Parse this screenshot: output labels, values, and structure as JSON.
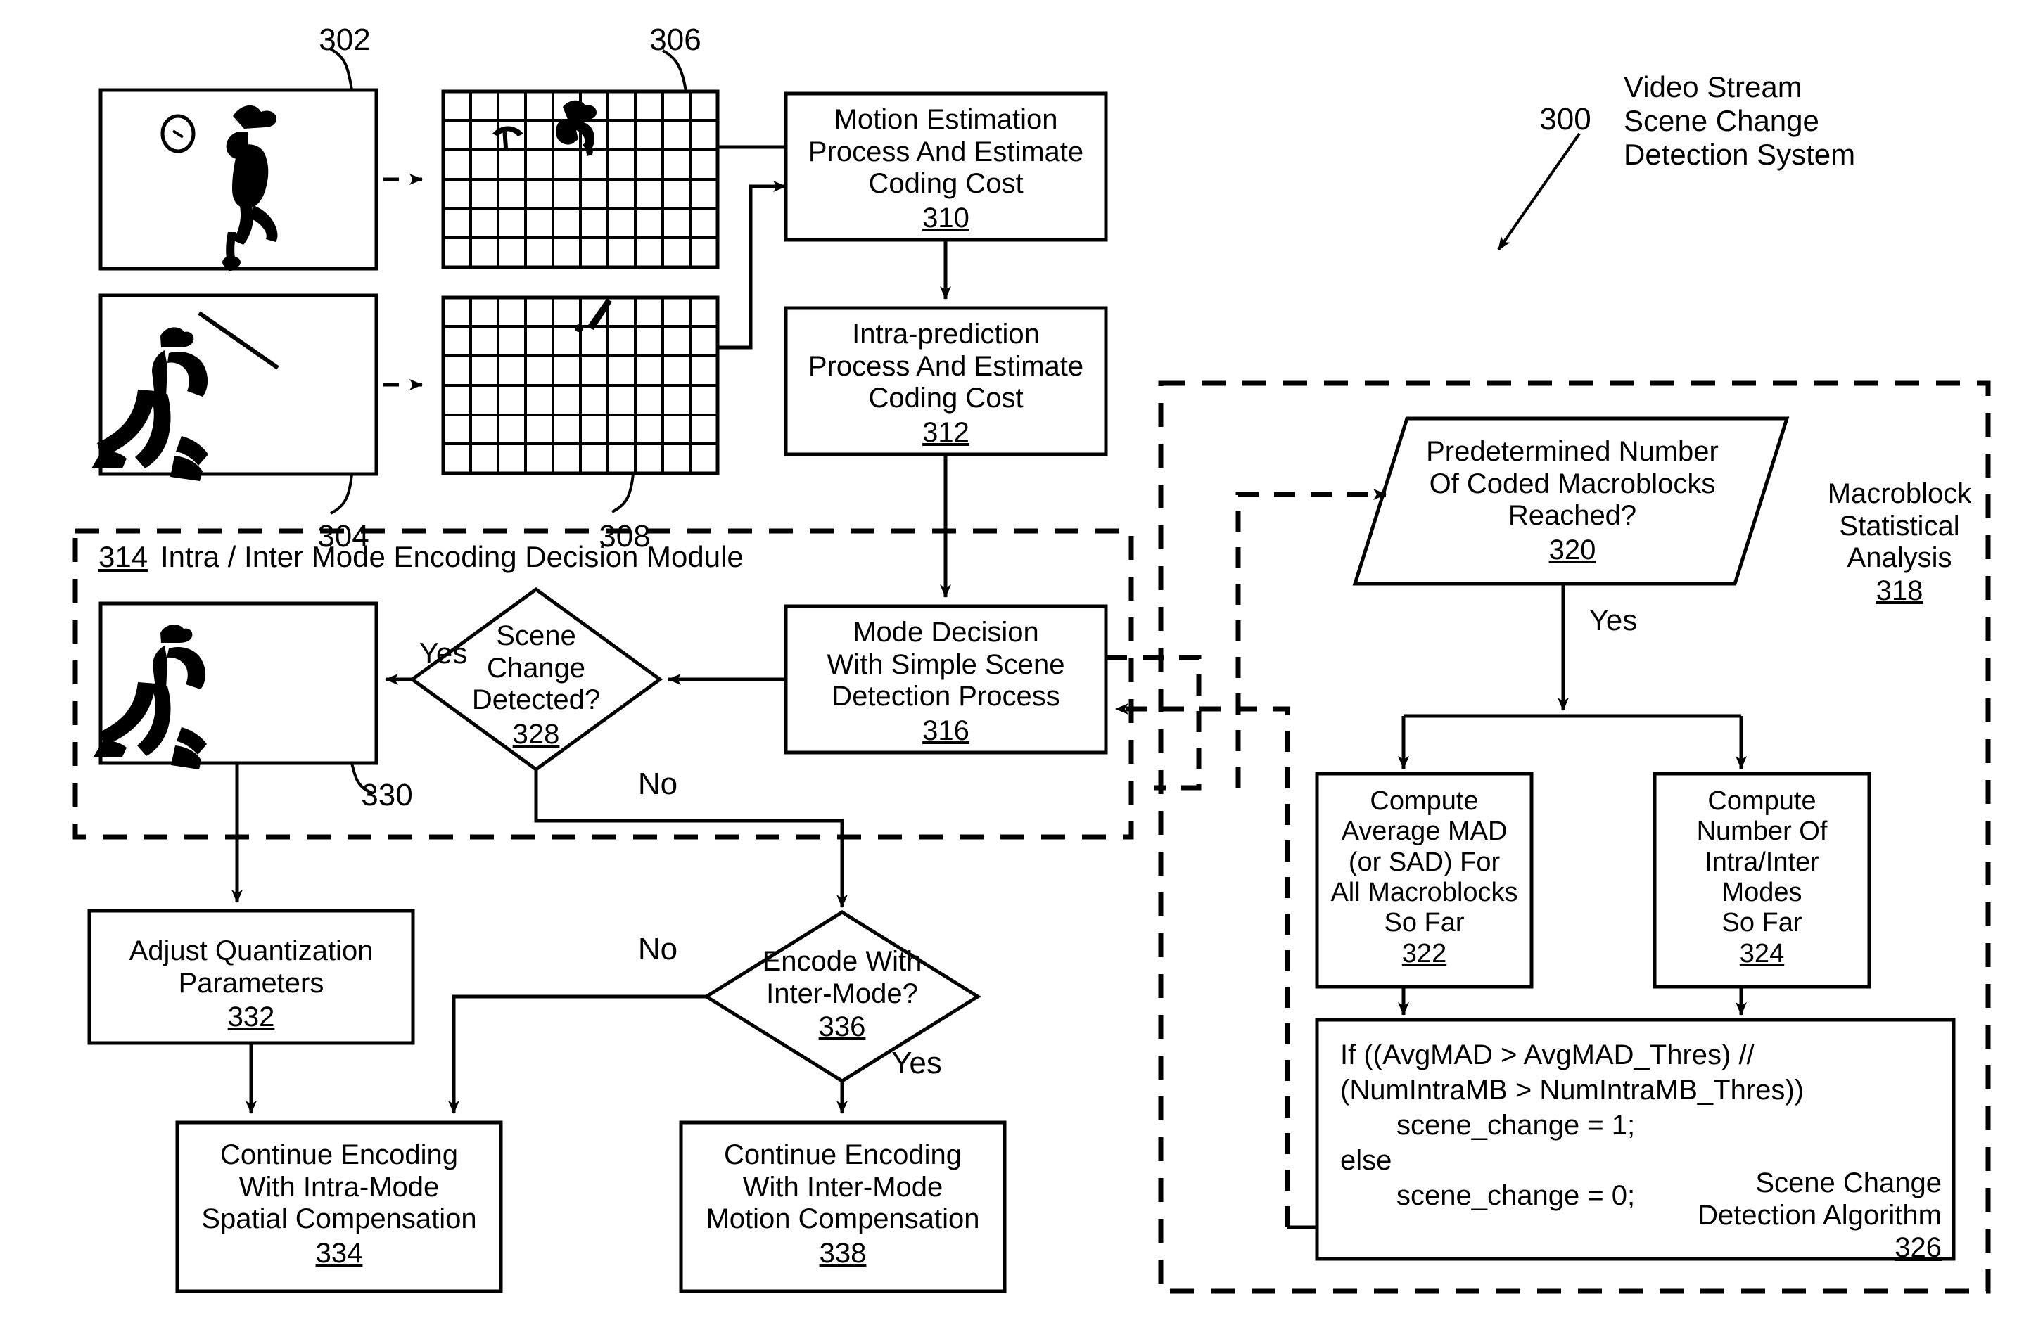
{
  "figure": {
    "ref_300": "300",
    "title": "Video Stream\nScene Change\nDetection System"
  },
  "frames": {
    "frame1_ref": "302",
    "frame2_ref": "304",
    "grid1_ref": "306",
    "grid2_ref": "308",
    "result_frame_ref": "330"
  },
  "boxes": {
    "b310": {
      "text": "Motion Estimation\nProcess And Estimate\nCoding Cost",
      "num": "310"
    },
    "b312": {
      "text": "Intra-prediction\nProcess And Estimate\nCoding Cost",
      "num": "312"
    },
    "b316": {
      "text": "Mode Decision\nWith Simple Scene\nDetection Process",
      "num": "316"
    },
    "b328": {
      "text": "Scene\nChange\nDetected?",
      "num": "328"
    },
    "b332": {
      "text": "Adjust Quantization\nParameters",
      "num": "332"
    },
    "b334": {
      "text": "Continue Encoding\nWith Intra-Mode\nSpatial Compensation",
      "num": "334"
    },
    "b336": {
      "text": "Encode With\nInter-Mode?",
      "num": "336"
    },
    "b338": {
      "text": "Continue Encoding\nWith Inter-Mode\nMotion Compensation",
      "num": "338"
    },
    "b320": {
      "text": "Predetermined Number\nOf Coded Macroblocks\nReached?",
      "num": "320"
    },
    "b322": {
      "text": "Compute\nAverage MAD\n(or SAD) For\nAll Macroblocks\nSo Far",
      "num": "322"
    },
    "b324": {
      "text": "Compute\nNumber Of\nIntra/Inter\nModes\nSo Far",
      "num": "324"
    },
    "b326": {
      "line1": "If ((AvgMAD > AvgMAD_Thres) //",
      "line2": "(NumIntraMB > NumIntraMB_Thres))",
      "line3": "scene_change = 1;",
      "line4": "else",
      "line5": "scene_change = 0;",
      "caption": "Scene Change\nDetection Algorithm",
      "num": "326"
    }
  },
  "modules": {
    "m314": {
      "num": "314",
      "label": "Intra / Inter Mode Encoding Decision Module"
    },
    "m318": {
      "label": "Macroblock\nStatistical\nAnalysis",
      "num": "318"
    }
  },
  "edge_labels": {
    "yes_328": "Yes",
    "no_328": "No",
    "no_336": "No",
    "yes_336": "Yes",
    "yes_320": "Yes"
  },
  "colors": {
    "ink": "#000000",
    "paper": "#ffffff"
  }
}
